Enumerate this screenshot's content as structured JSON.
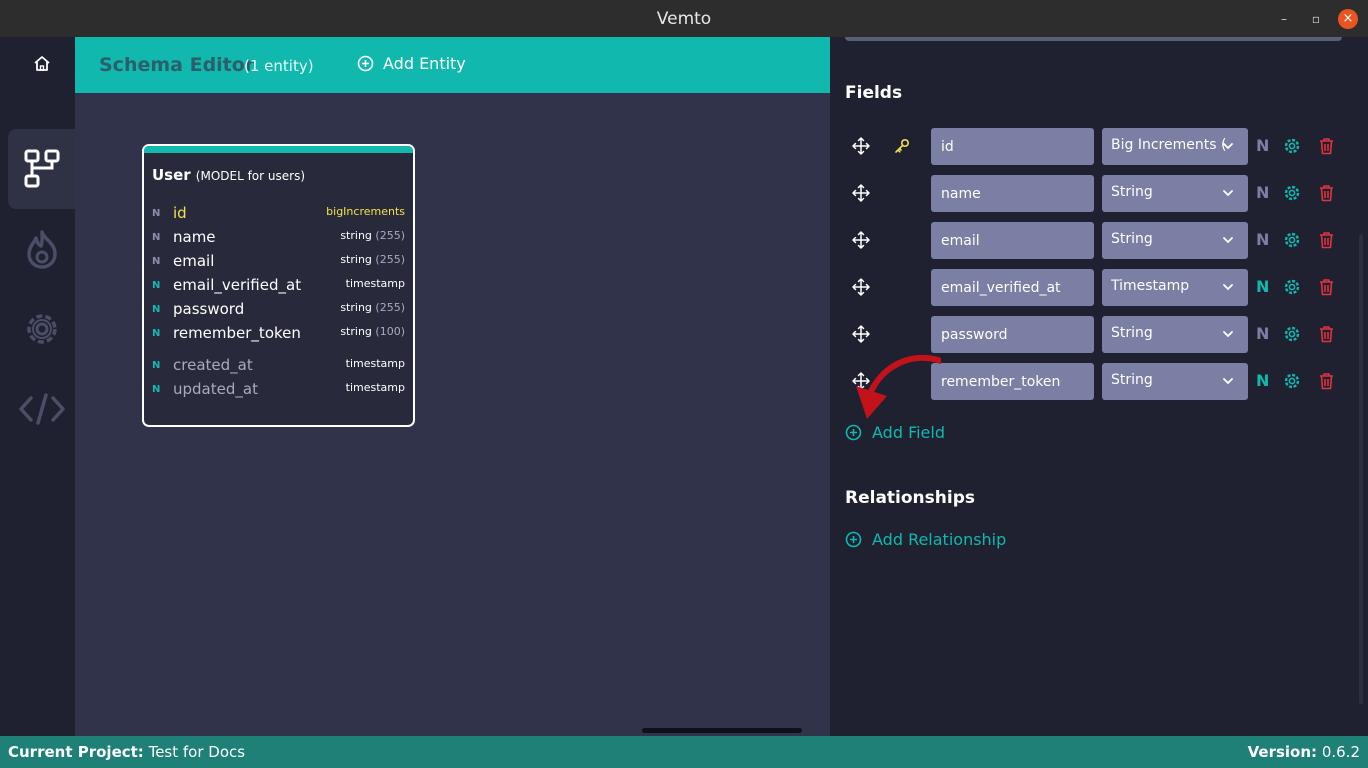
{
  "window": {
    "title": "Vemto",
    "minimize": "–",
    "maximize": "▫",
    "close": "×"
  },
  "sidebar": {
    "items": [
      {
        "icon": "home-icon"
      },
      {
        "icon": "schema-icon",
        "active": true
      },
      {
        "icon": "fire-icon"
      },
      {
        "icon": "gear-icon"
      },
      {
        "icon": "code-icon"
      }
    ]
  },
  "header": {
    "title": "Schema Editor",
    "count": "(1 entity)",
    "add_entity": "Add Entity"
  },
  "entity": {
    "name": "User",
    "subtitle": "(MODEL for users)",
    "fields": [
      {
        "nullable": "N",
        "name": "id",
        "type": "bigIncrements",
        "length": ""
      },
      {
        "nullable": "N",
        "name": "name",
        "type": "string",
        "length": "(255)"
      },
      {
        "nullable": "N",
        "name": "email",
        "type": "string",
        "length": "(255)"
      },
      {
        "nullable": "N",
        "name": "email_verified_at",
        "type": "timestamp",
        "length": ""
      },
      {
        "nullable": "N",
        "name": "password",
        "type": "string",
        "length": "(255)"
      },
      {
        "nullable": "N",
        "name": "remember_token",
        "type": "string",
        "length": "(100)"
      },
      {
        "nullable": "N",
        "name": "created_at",
        "type": "timestamp",
        "length": ""
      },
      {
        "nullable": "N",
        "name": "updated_at",
        "type": "timestamp",
        "length": ""
      }
    ]
  },
  "panel": {
    "fields_title": "Fields",
    "fields": [
      {
        "name": "id",
        "type": "Big Increments (I",
        "nullable": "N",
        "nullable_on": false
      },
      {
        "name": "name",
        "type": "String",
        "nullable": "N",
        "nullable_on": false
      },
      {
        "name": "email",
        "type": "String",
        "nullable": "N",
        "nullable_on": false
      },
      {
        "name": "email_verified_at",
        "type": "Timestamp",
        "nullable": "N",
        "nullable_on": true
      },
      {
        "name": "password",
        "type": "String",
        "nullable": "N",
        "nullable_on": false
      },
      {
        "name": "remember_token",
        "type": "String",
        "nullable": "N",
        "nullable_on": true
      }
    ],
    "add_field": "Add Field",
    "relationships_title": "Relationships",
    "add_relationship": "Add Relationship"
  },
  "status": {
    "project_label": "Current Project:",
    "project_name": "Test for Docs",
    "version_label": "Version:",
    "version": "0.6.2"
  },
  "colors": {
    "accent": "#10b8ae",
    "danger": "#e0323f",
    "primary_key": "#f2e24b"
  }
}
